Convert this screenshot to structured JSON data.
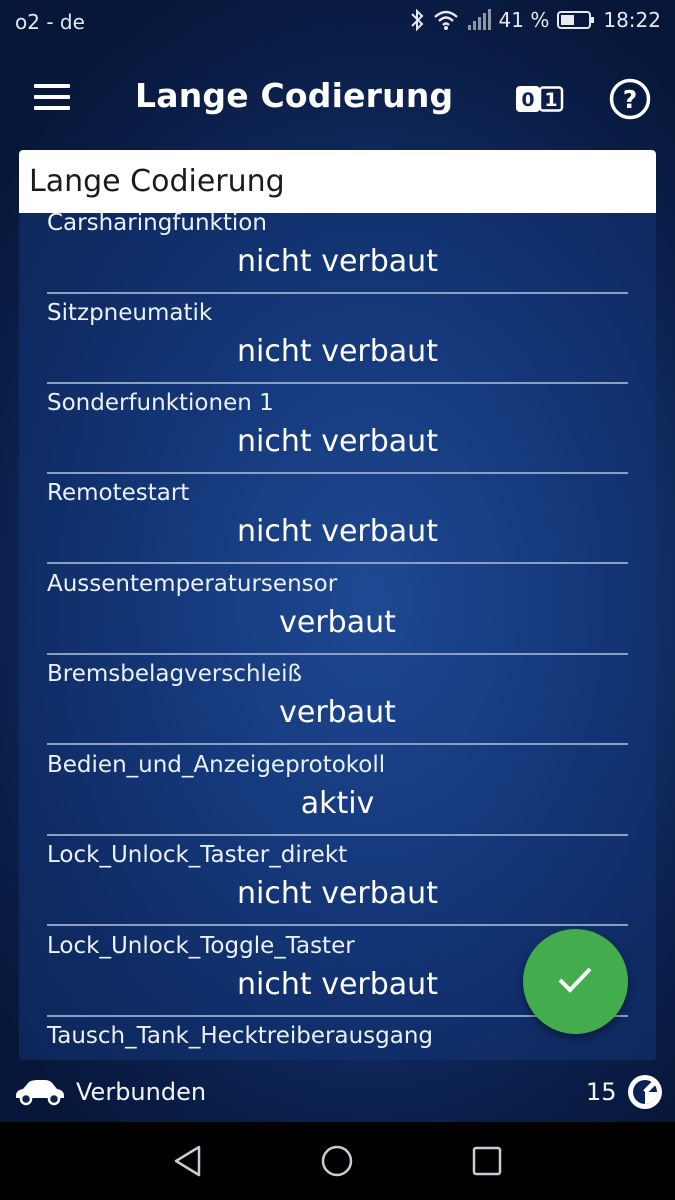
{
  "status_bar": {
    "carrier": "o2 - de",
    "battery": "41 %",
    "time": "18:22",
    "icons": [
      "bluetooth-icon",
      "wifi-icon",
      "signal-icon",
      "battery-icon"
    ]
  },
  "app_bar": {
    "title": "Lange Codierung",
    "bits_label_0": "0",
    "bits_label_1": "1",
    "help_label": "?"
  },
  "panel": {
    "header": "Lange Codierung",
    "items": [
      {
        "label": "Carsharingfunktion",
        "value": "nicht verbaut"
      },
      {
        "label": "Sitzpneumatik",
        "value": "nicht verbaut"
      },
      {
        "label": "Sonderfunktionen 1",
        "value": "nicht verbaut"
      },
      {
        "label": "Remotestart",
        "value": "nicht verbaut"
      },
      {
        "label": "Aussentemperatursensor",
        "value": "verbaut"
      },
      {
        "label": "Bremsbelagverschleiß",
        "value": "verbaut"
      },
      {
        "label": "Bedien_und_Anzeigeprotokoll",
        "value": "aktiv"
      },
      {
        "label": "Lock_Unlock_Taster_direkt",
        "value": "nicht verbaut"
      },
      {
        "label": "Lock_Unlock_Toggle_Taster",
        "value": "nicht verbaut"
      },
      {
        "label": "Tausch_Tank_Hecktreiberausgang",
        "value": ""
      }
    ]
  },
  "fab": {
    "icon": "check-icon",
    "color": "#43ac4c"
  },
  "footer": {
    "status": "Verbunden",
    "count": "15",
    "icons": [
      "car-icon",
      "gauge-icon"
    ]
  },
  "nav_bar": {
    "icons": [
      "back-icon",
      "home-icon",
      "recents-icon"
    ]
  }
}
